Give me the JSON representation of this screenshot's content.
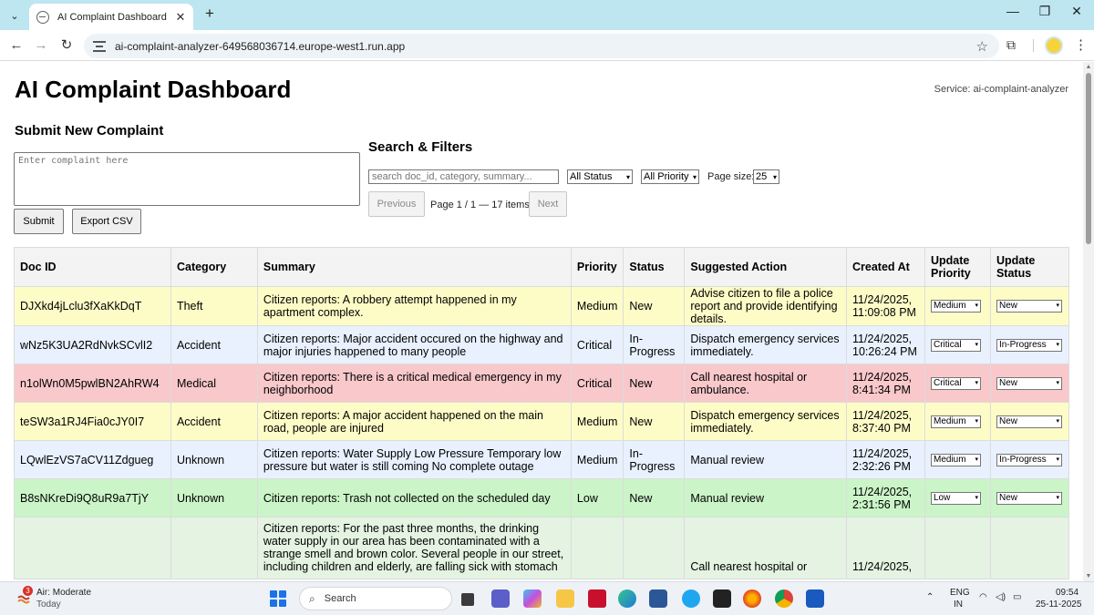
{
  "browser": {
    "tab_title": "AI Complaint Dashboard",
    "url": "ai-complaint-analyzer-649568036714.europe-west1.run.app"
  },
  "header": {
    "title": "AI Complaint Dashboard",
    "service": "Service: ai-complaint-analyzer"
  },
  "submit": {
    "heading": "Submit New Complaint",
    "placeholder": "Enter complaint here",
    "submit_label": "Submit",
    "export_label": "Export CSV"
  },
  "filters": {
    "heading": "Search & Filters",
    "search_placeholder": "search doc_id, category, summary...",
    "status_value": "All Status",
    "priority_value": "All Priority",
    "page_size_label": "Page size:",
    "page_size_value": "25",
    "prev_label": "Previous",
    "page_info": "Page 1 / 1 — 17 items",
    "next_label": "Next"
  },
  "table": {
    "headers": [
      "Doc ID",
      "Category",
      "Summary",
      "Priority",
      "Status",
      "Suggested Action",
      "Created At",
      "Update Priority",
      "Update Status"
    ],
    "rows": [
      {
        "doc_id": "DJXkd4jLclu3fXaKkDqT",
        "category": "Theft",
        "summary": "Citizen reports: A robbery attempt happened in my apartment complex.",
        "priority": "Medium",
        "status": "New",
        "action": "Advise citizen to file a police report and provide identifying details.",
        "created": "11/24/2025, 11:09:08 PM",
        "upd_priority": "Medium",
        "upd_status": "New"
      },
      {
        "doc_id": "wNz5K3UA2RdNvkSCvlI2",
        "category": "Accident",
        "summary": "Citizen reports: Major accident occured on the highway and major injuries happened to many people",
        "priority": "Critical",
        "status": "In-Progress",
        "action": "Dispatch emergency services immediately.",
        "created": "11/24/2025, 10:26:24 PM",
        "upd_priority": "Critical",
        "upd_status": "In-Progress"
      },
      {
        "doc_id": "n1olWn0M5pwlBN2AhRW4",
        "category": "Medical",
        "summary": "Citizen reports: There is a critical medical emergency in my neighborhood",
        "priority": "Critical",
        "status": "New",
        "action": "Call nearest hospital or ambulance.",
        "created": "11/24/2025, 8:41:34 PM",
        "upd_priority": "Critical",
        "upd_status": "New"
      },
      {
        "doc_id": "teSW3a1RJ4Fia0cJY0I7",
        "category": "Accident",
        "summary": "Citizen reports: A major accident happened on the main road, people are injured",
        "priority": "Medium",
        "status": "New",
        "action": "Dispatch emergency services immediately.",
        "created": "11/24/2025, 8:37:40 PM",
        "upd_priority": "Medium",
        "upd_status": "New"
      },
      {
        "doc_id": "LQwlEzVS7aCV11Zdgueg",
        "category": "Unknown",
        "summary": "Citizen reports: Water Supply Low Pressure Temporary low pressure but water is still coming No complete outage",
        "priority": "Medium",
        "status": "In-Progress",
        "action": "Manual review",
        "created": "11/24/2025, 2:32:26 PM",
        "upd_priority": "Medium",
        "upd_status": "In-Progress"
      },
      {
        "doc_id": "B8sNKreDi9Q8uR9a7TjY",
        "category": "Unknown",
        "summary": "Citizen reports: Trash not collected on the scheduled day",
        "priority": "Low",
        "status": "New",
        "action": "Manual review",
        "created": "11/24/2025, 2:31:56 PM",
        "upd_priority": "Low",
        "upd_status": "New"
      },
      {
        "doc_id": "",
        "category": "",
        "summary": "Citizen reports: For the past three months, the drinking water supply in our area has been contaminated with a strange smell and brown color. Several people in our street, including children and elderly, are falling sick with stomach",
        "priority": "",
        "status": "",
        "action": "Call nearest hospital or",
        "created": "11/24/2025,",
        "upd_priority": "",
        "upd_status": ""
      }
    ]
  },
  "taskbar": {
    "weather_badge": "3",
    "weather_line1": "Air: Moderate",
    "weather_line2": "Today",
    "search_label": "Search",
    "lang_line1": "ENG",
    "lang_line2": "IN",
    "time": "09:54",
    "date": "25-11-2025"
  },
  "colors": {
    "row_medium": "#fdfcc7",
    "row_inprogress": "#e8f1fd",
    "row_critical": "#f8c8cb",
    "row_low": "#cbf5c8",
    "tabbar": "#bde6f1"
  }
}
